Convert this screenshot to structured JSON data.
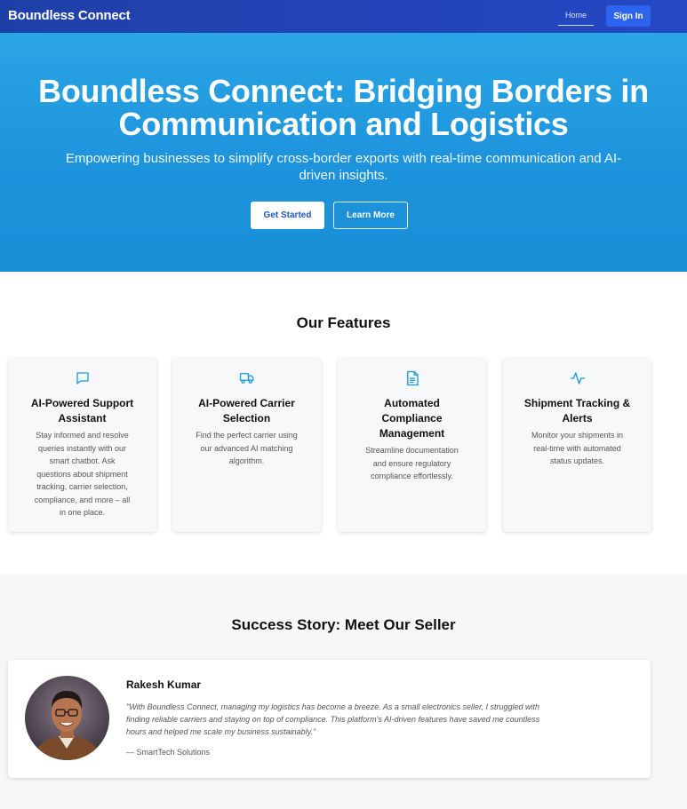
{
  "nav": {
    "brand": "Boundless Connect",
    "home_label": "Home",
    "signin_label": "Sign In"
  },
  "hero": {
    "title_line1": "Boundless Connect: Bridging Borders in",
    "title_line2": "Communication and Logistics",
    "subtitle_line1": "Empowering businesses to simplify cross-border exports with real-time communication and AI-",
    "subtitle_line2": "driven insights.",
    "primary_button": "Get Started",
    "secondary_button": "Learn More"
  },
  "features": {
    "title": "Our Features",
    "items": [
      {
        "icon": "chat-bubble-icon",
        "title_lines": [
          "AI-Powered Support",
          "Assistant"
        ],
        "desc_lines": [
          "Stay informed and resolve",
          "queries instantly with our",
          "smart chatbot. Ask",
          "questions about shipment",
          "tracking, carrier selection,",
          "compliance, and more – all",
          "in one place."
        ]
      },
      {
        "icon": "truck-icon",
        "title_lines": [
          "AI-Powered Carrier",
          "Selection"
        ],
        "desc_lines": [
          "Find the perfect carrier using",
          "our advanced AI matching",
          "algorithm."
        ]
      },
      {
        "icon": "document-icon",
        "title_lines": [
          "Automated",
          "Compliance",
          "Management"
        ],
        "desc_lines": [
          "Streamline documentation",
          "and ensure regulatory",
          "compliance effortlessly."
        ]
      },
      {
        "icon": "activity-icon",
        "title_lines": [
          "Shipment Tracking &",
          "Alerts"
        ],
        "desc_lines": [
          "Monitor your shipments in",
          "real-time with automated",
          "status updates."
        ]
      }
    ]
  },
  "story": {
    "title": "Success Story: Meet Our Seller",
    "name": "Rakesh Kumar",
    "quote_lines": [
      "\"With Boundless Connect, managing my logistics has become a breeze. As a small electronics seller, I struggled with",
      "finding reliable carriers and staying on top of compliance. This platform's AI-driven features have saved me countless",
      "hours and helped me scale my business sustainably.\""
    ],
    "company": "— SmartTech Solutions"
  },
  "colors": {
    "nav_bg": "#2548c4",
    "hero_bg": "#1d93dc",
    "accent_icon": "#1a9bd7",
    "signin_bg": "#2c63ef"
  }
}
